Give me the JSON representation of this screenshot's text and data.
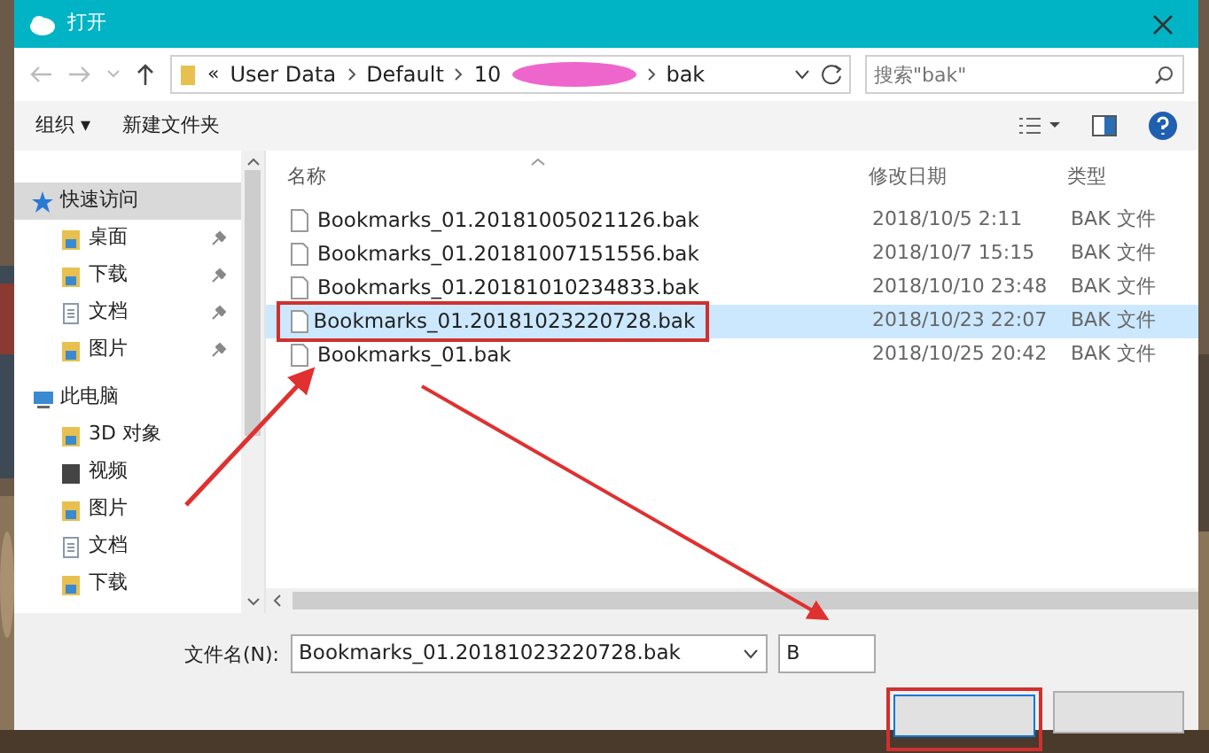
{
  "window": {
    "title": "打开"
  },
  "nav": {
    "overflow": "«",
    "path": [
      "User Data",
      "Default",
      "10",
      "bak"
    ],
    "search": {
      "placeholder": "搜索\"bak\""
    }
  },
  "toolbar": {
    "organize": "组织 ▾",
    "new_folder": "新建文件夹"
  },
  "sidebar": [
    {
      "label": "快速访问",
      "kind": "star",
      "selected": true,
      "children": [
        {
          "label": "桌面",
          "kind": "folder",
          "pinned": true
        },
        {
          "label": "下载",
          "kind": "folder",
          "pinned": true
        },
        {
          "label": "文档",
          "kind": "doc",
          "pinned": true
        },
        {
          "label": "图片",
          "kind": "folder",
          "pinned": true
        }
      ]
    },
    {
      "label": "此电脑",
      "kind": "pc",
      "selected": false,
      "children": [
        {
          "label": "3D 对象",
          "kind": "folder",
          "pinned": false
        },
        {
          "label": "视频",
          "kind": "video",
          "pinned": false
        },
        {
          "label": "图片",
          "kind": "folder",
          "pinned": false
        },
        {
          "label": "文档",
          "kind": "doc",
          "pinned": false
        },
        {
          "label": "下载",
          "kind": "folder",
          "pinned": false
        }
      ]
    }
  ],
  "columns": [
    "名称",
    "修改日期",
    "类型"
  ],
  "rows": [
    {
      "name": "Bookmarks_01.20181005021126.bak",
      "date": "2018/10/5 2:11",
      "type": "BAK 文件",
      "selected": false,
      "marked": false
    },
    {
      "name": "Bookmarks_01.20181007151556.bak",
      "date": "2018/10/7 15:15",
      "type": "BAK 文件",
      "selected": false,
      "marked": false
    },
    {
      "name": "Bookmarks_01.20181010234833.bak",
      "date": "2018/10/10 23:48",
      "type": "BAK 文件",
      "selected": false,
      "marked": false
    },
    {
      "name": "Bookmarks_01.20181023220728.bak",
      "date": "2018/10/23 22:07",
      "type": "BAK 文件",
      "selected": true,
      "marked": true
    },
    {
      "name": "Bookmarks_01.bak",
      "date": "2018/10/25 20:42",
      "type": "BAK 文件",
      "selected": false,
      "marked": false
    }
  ],
  "footer": {
    "filename_label": "文件名(N):",
    "filename": "Bookmarks_01.20181023220728.bak",
    "filetype": "B",
    "open_marked": true
  }
}
